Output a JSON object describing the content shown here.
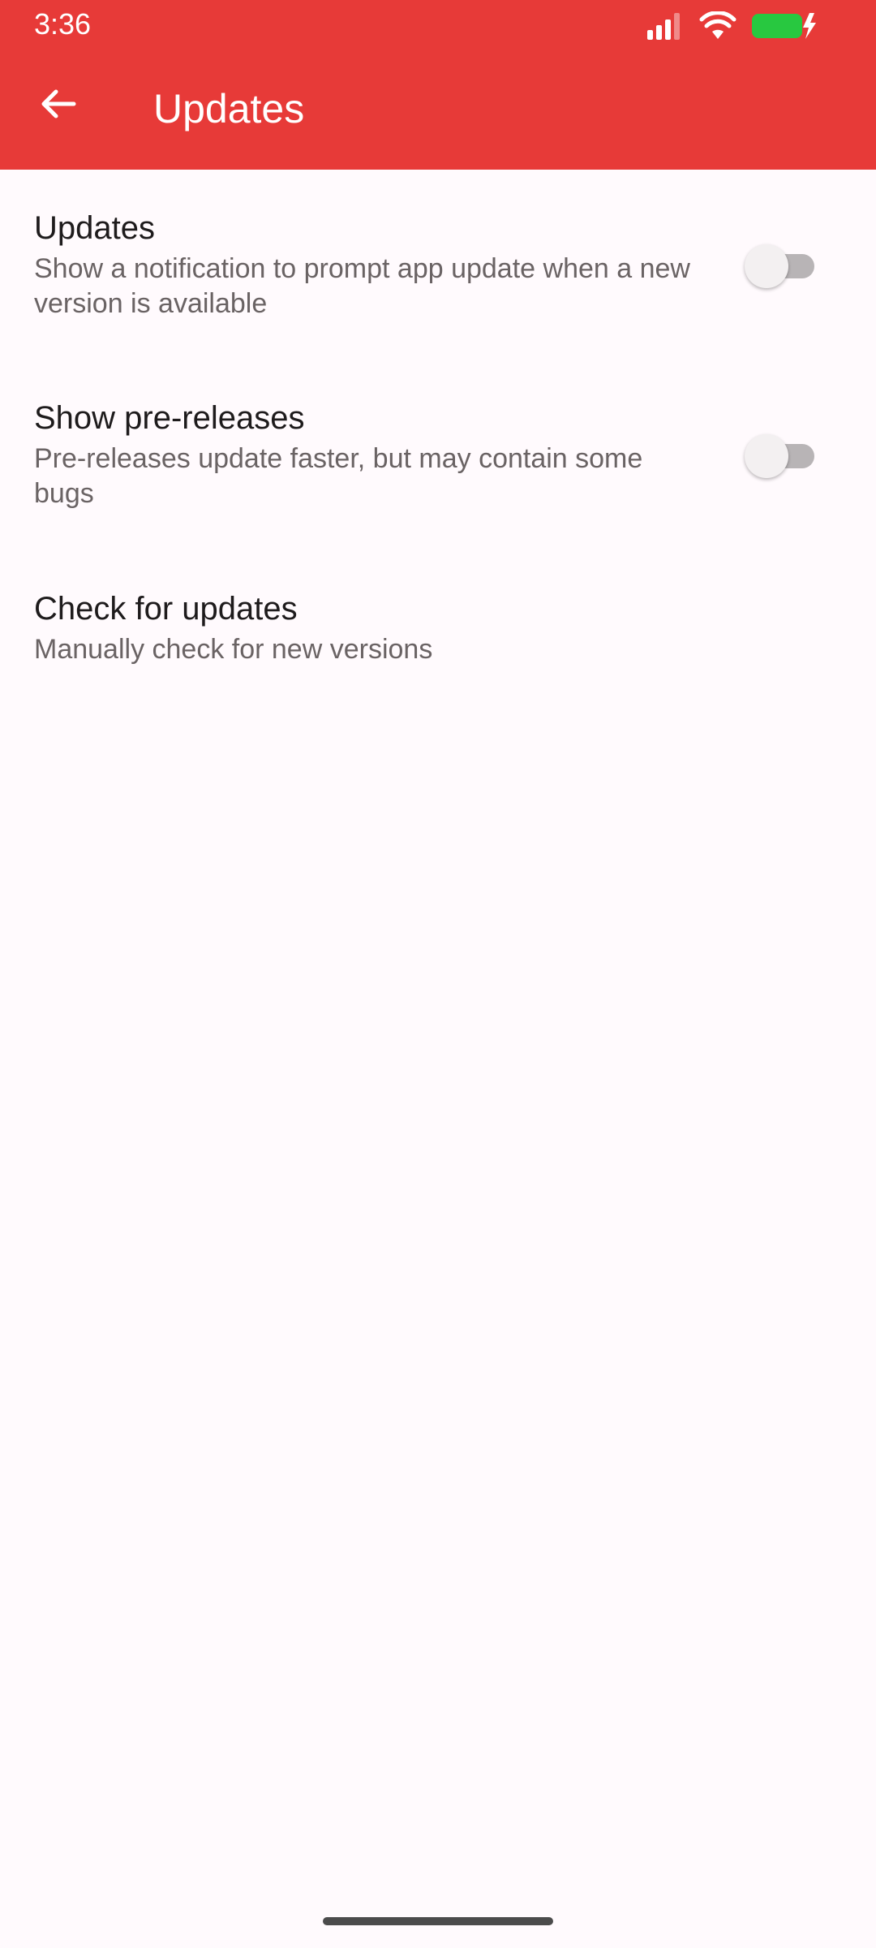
{
  "status_bar": {
    "time": "3:36",
    "icons": [
      "signal-icon",
      "wifi-icon",
      "battery-charging-icon"
    ],
    "battery_color": "#28c840"
  },
  "app_bar": {
    "title": "Updates",
    "back_icon": "arrow-left-icon",
    "background": "#e73a38"
  },
  "settings": [
    {
      "title": "Updates",
      "summary": "Show a notification to prompt app update when a new version is available",
      "toggle": false
    },
    {
      "title": "Show pre-releases",
      "summary": "Pre-releases update faster, but may contain some bugs",
      "toggle": false
    },
    {
      "title": "Check for updates",
      "summary": "Manually check for new versions"
    }
  ]
}
